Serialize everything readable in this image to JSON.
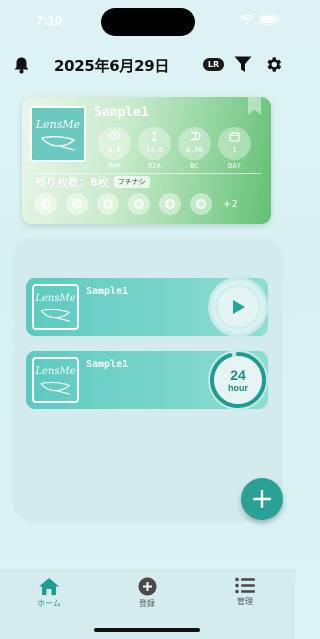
{
  "status_bar": {
    "time": "7:10"
  },
  "header": {
    "date": "2025年6月29日",
    "lr_badge": "LR"
  },
  "lens_card": {
    "name": "Sample1",
    "logo_text": "LensMe",
    "specs": [
      {
        "icon": "eye-icon",
        "value": "0.0",
        "label": "PWR"
      },
      {
        "icon": "diameter-icon",
        "value": "14.0",
        "label": "DIA"
      },
      {
        "icon": "curve-icon",
        "value": "8.60",
        "label": "BC"
      },
      {
        "icon": "calendar-icon",
        "value": "1",
        "label": "DAY"
      }
    ],
    "remaining": "残り枚数：8枚",
    "tag": "フチナシ",
    "more_count": "+2"
  },
  "list": {
    "rows": [
      {
        "name": "Sample1",
        "logo_text": "LensMe",
        "action": "play"
      },
      {
        "name": "Sample1",
        "logo_text": "LensMe",
        "action": "timer",
        "timer_value": "24",
        "timer_unit": "hour",
        "timer_progress": 0.95
      }
    ]
  },
  "tab_bar": {
    "home": "ホーム",
    "register": "登録",
    "manage": "管理"
  },
  "colors": {
    "accent": "#2aa196",
    "card_green": "#62c072",
    "row_teal": "#5ccac0"
  }
}
